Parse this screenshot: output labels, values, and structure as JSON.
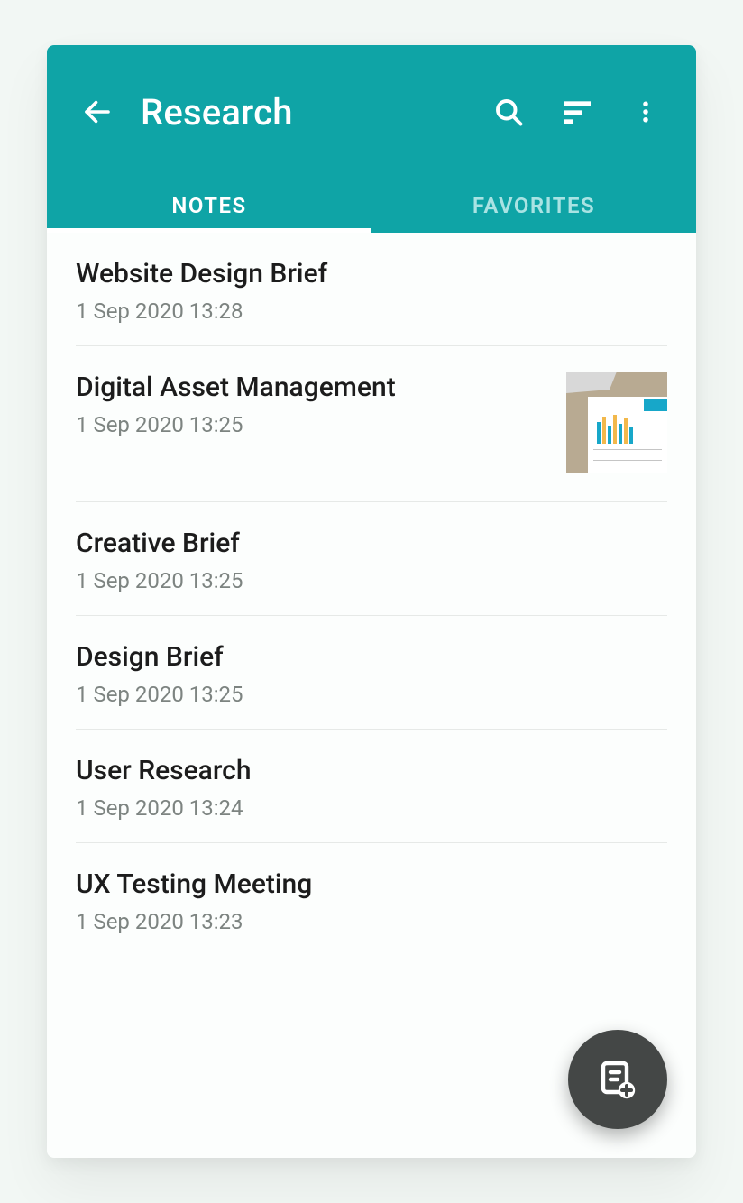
{
  "appbar": {
    "title": "Research",
    "back_icon": "back-arrow-icon",
    "search_icon": "search-icon",
    "sort_icon": "sort-icon",
    "menu_icon": "more-vert-icon"
  },
  "tabs": {
    "items": [
      {
        "label": "NOTES",
        "active": true
      },
      {
        "label": "FAVORITES",
        "active": false
      }
    ]
  },
  "notes": [
    {
      "title": "Website Design Brief",
      "date": "1 Sep 2020 13:28",
      "has_thumb": false
    },
    {
      "title": "Digital Asset Management",
      "date": "1 Sep 2020 13:25",
      "has_thumb": true
    },
    {
      "title": "Creative Brief",
      "date": "1 Sep 2020 13:25",
      "has_thumb": false
    },
    {
      "title": "Design Brief",
      "date": "1 Sep 2020 13:25",
      "has_thumb": false
    },
    {
      "title": "User Research",
      "date": "1 Sep 2020 13:24",
      "has_thumb": false
    },
    {
      "title": "UX Testing Meeting",
      "date": "1 Sep 2020 13:23",
      "has_thumb": false
    }
  ],
  "fab": {
    "icon": "note-add-icon"
  },
  "colors": {
    "primary": "#0fa4a6",
    "fab": "#444746"
  }
}
